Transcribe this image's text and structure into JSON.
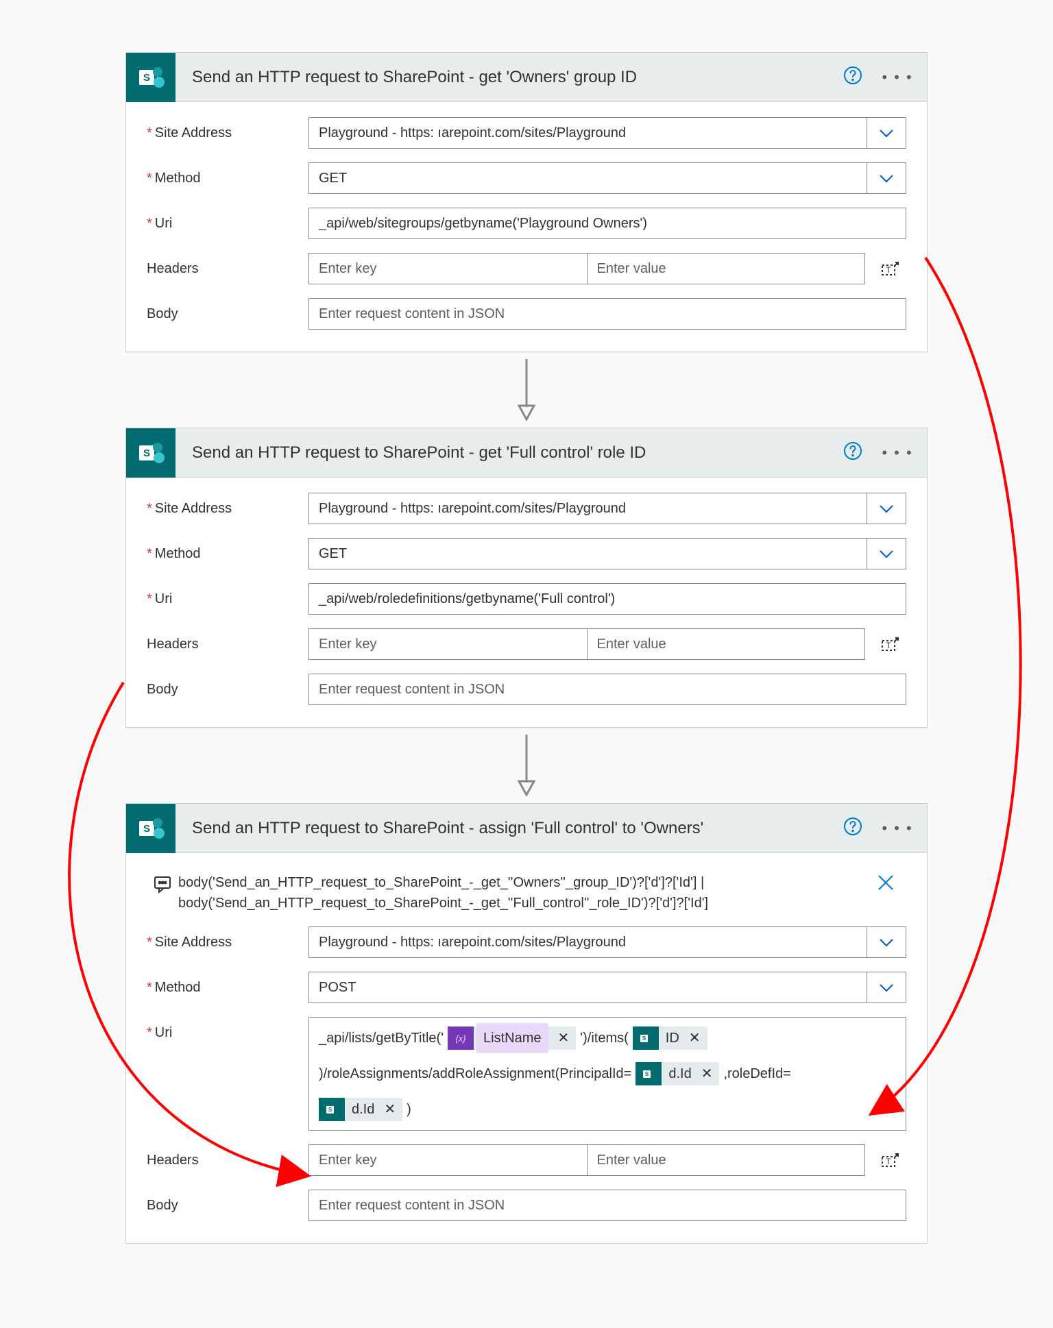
{
  "icons": {
    "help_tooltip": "Help",
    "menu_tooltip": "More"
  },
  "site_address_display": "Playground - https:                        ıarepoint.com/sites/Playground",
  "headers_key_placeholder": "Enter key",
  "headers_value_placeholder": "Enter value",
  "body_placeholder": "Enter request content in JSON",
  "labels": {
    "site_address": "Site Address",
    "method": "Method",
    "uri": "Uri",
    "headers": "Headers",
    "body": "Body"
  },
  "cards": [
    {
      "title": "Send an HTTP request to SharePoint - get 'Owners' group ID",
      "method": "GET",
      "uri": "_api/web/sitegroups/getbyname('Playground Owners')"
    },
    {
      "title": "Send an HTTP request to SharePoint - get 'Full control' role ID",
      "method": "GET",
      "uri": "_api/web/roledefinitions/getbyname('Full control')"
    },
    {
      "title": "Send an HTTP request to SharePoint - assign 'Full control' to 'Owners'",
      "method": "POST",
      "peek_line1": "body('Send_an_HTTP_request_to_SharePoint_-_get_''Owners''_group_ID')?['d']?['Id'] |",
      "peek_line2": "body('Send_an_HTTP_request_to_SharePoint_-_get_''Full_control''_role_ID')?['d']?['Id']",
      "uri_parts": {
        "p0": "_api/lists/getByTitle('",
        "t0": "ListName",
        "p1": "')/items(",
        "t1": "ID",
        "p2": ")/roleAssignments/addRoleAssignment(PrincipalId=",
        "t2": "d.Id",
        "p3": ",roleDefId=",
        "t3": "d.Id",
        "p4": ")"
      }
    }
  ]
}
